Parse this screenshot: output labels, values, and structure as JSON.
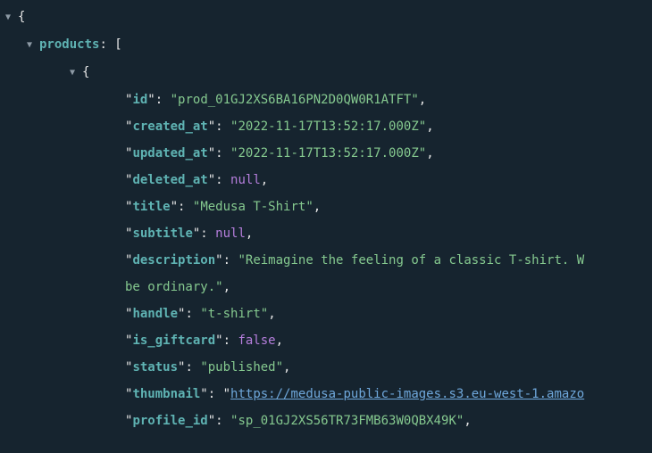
{
  "root_key": "products",
  "fields": {
    "id": {
      "key": "id",
      "value": "prod_01GJ2XS6BA16PN2D0QW0R1ATFT",
      "type": "string"
    },
    "created_at": {
      "key": "created_at",
      "value": "2022-11-17T13:52:17.000Z",
      "type": "string"
    },
    "updated_at": {
      "key": "updated_at",
      "value": "2022-11-17T13:52:17.000Z",
      "type": "string"
    },
    "deleted_at": {
      "key": "deleted_at",
      "value": "null",
      "type": "null"
    },
    "title": {
      "key": "title",
      "value": "Medusa T-Shirt",
      "type": "string"
    },
    "subtitle": {
      "key": "subtitle",
      "value": "null",
      "type": "null"
    },
    "description_a": "Reimagine the feeling of a classic T-shirt. W",
    "description_b": "be ordinary.",
    "handle": {
      "key": "handle",
      "value": "t-shirt",
      "type": "string"
    },
    "is_giftcard": {
      "key": "is_giftcard",
      "value": "false",
      "type": "bool"
    },
    "status": {
      "key": "status",
      "value": "published",
      "type": "string"
    },
    "thumbnail": {
      "key": "thumbnail",
      "value": "https://medusa-public-images.s3.eu-west-1.amazo",
      "type": "link"
    },
    "profile_id": {
      "key": "profile_id",
      "value": "sp_01GJ2XS56TR73FMB63W0QBX49K",
      "type": "string"
    }
  }
}
